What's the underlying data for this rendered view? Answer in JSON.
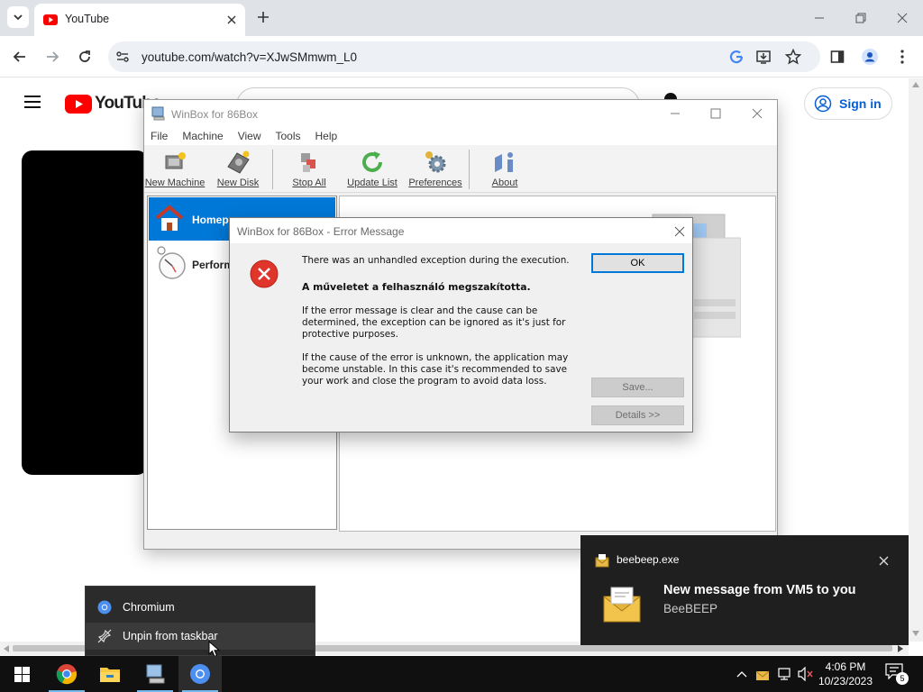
{
  "browser": {
    "tab": {
      "title": "YouTube",
      "favicon": "youtube-favicon"
    },
    "url": "youtube.com/watch?v=XJwSMmwm_L0"
  },
  "youtube": {
    "logo_text": "YouTube",
    "sign_in": "Sign in"
  },
  "winbox": {
    "title": "WinBox for 86Box",
    "menu": [
      "File",
      "Machine",
      "View",
      "Tools",
      "Help"
    ],
    "toolbar": [
      {
        "label": "New Machine",
        "icon": "new-machine-icon"
      },
      {
        "label": "New Disk",
        "icon": "new-disk-icon"
      },
      {
        "label": "Stop All",
        "icon": "stop-all-icon"
      },
      {
        "label": "Update List",
        "icon": "update-list-icon"
      },
      {
        "label": "Preferences",
        "icon": "preferences-icon"
      },
      {
        "label": "About",
        "icon": "about-icon"
      }
    ],
    "left_items": [
      "Homep",
      "Perform"
    ]
  },
  "error_dialog": {
    "title": "WinBox for 86Box - Error Message",
    "line1": "There was an unhandled exception during the execution.",
    "line2": "A műveletet a felhasználó megszakította.",
    "p1": "If the error message is clear and the cause can be determined, the exception can be ignored as it's just for protective purposes.",
    "p2": "If the cause of the error is unknown, the application may become unstable. In this case it's recommended to save your work and close the program to avoid data loss.",
    "ok": "OK",
    "save": "Save...",
    "details": "Details >>"
  },
  "toast": {
    "app": "beebeep.exe",
    "title": "New message from VM5 to you",
    "body": "BeeBEEP"
  },
  "jumplist": {
    "items": [
      "Chromium",
      "Unpin from taskbar"
    ]
  },
  "taskbar": {
    "time": "4:06 PM",
    "date": "10/23/2023",
    "notifications": "5"
  },
  "colors": {
    "accent": "#0078d7",
    "youtube_red": "#ff0000",
    "error_red": "#e0352b",
    "taskbar": "#101010"
  }
}
